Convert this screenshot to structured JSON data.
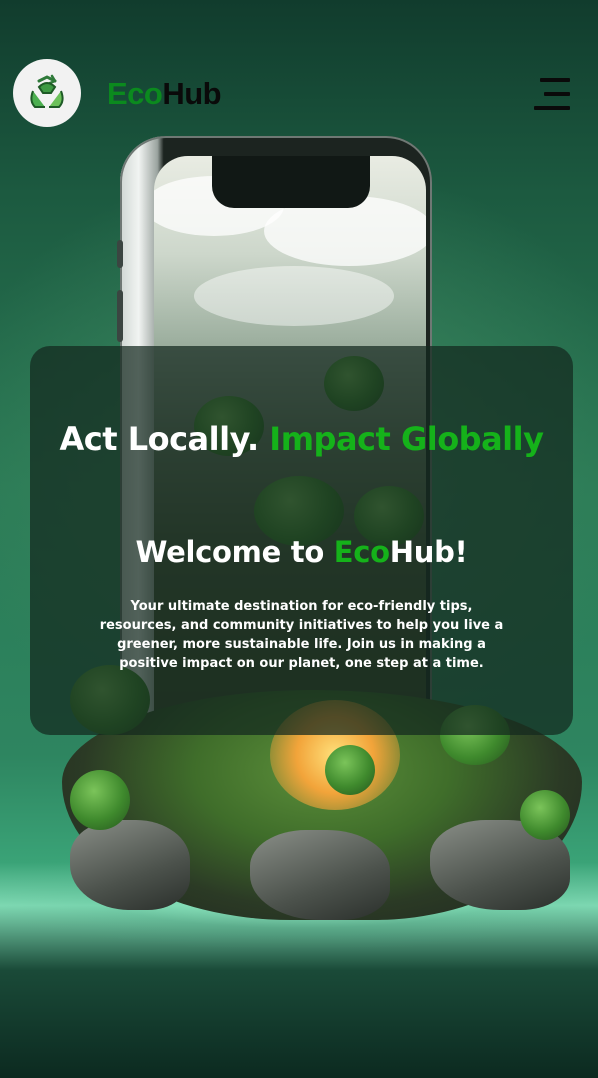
{
  "header": {
    "brand_part1": "Eco",
    "brand_part2": "Hub",
    "logo_icon": "recycle-icon",
    "menu_icon": "hamburger-menu-icon"
  },
  "hero": {
    "headline_white": "Act Locally.",
    "headline_green": "Impact Globally",
    "welcome_prefix": "Welcome to ",
    "welcome_eco": "Eco",
    "welcome_hub": "Hub!",
    "intro": "Your ultimate destination for eco-friendly tips, resources, and community initiatives to help you live a greener, more sustainable life. Join us in making a positive impact on our planet, one step at a time."
  },
  "colors": {
    "accent_green": "#15b21a",
    "brand_green": "#0b8a1e",
    "dark_text": "#0a0a0a",
    "card_overlay": "rgba(20,40,30,0.72)"
  }
}
